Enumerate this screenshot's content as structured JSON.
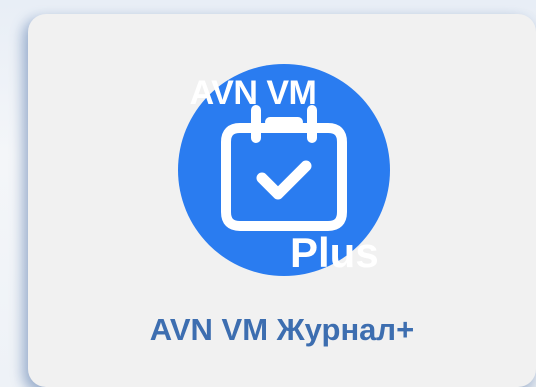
{
  "app_tile": {
    "icon_top_text": "AVN VM",
    "icon_badge_text": "Plus",
    "icon_name": "calendar-check-icon",
    "label": "AVN VM Журнал+",
    "colors": {
      "icon_circle": "#2a7cf0",
      "label_text": "#3d6eb0",
      "tile_background": "#f1f1f1"
    }
  }
}
